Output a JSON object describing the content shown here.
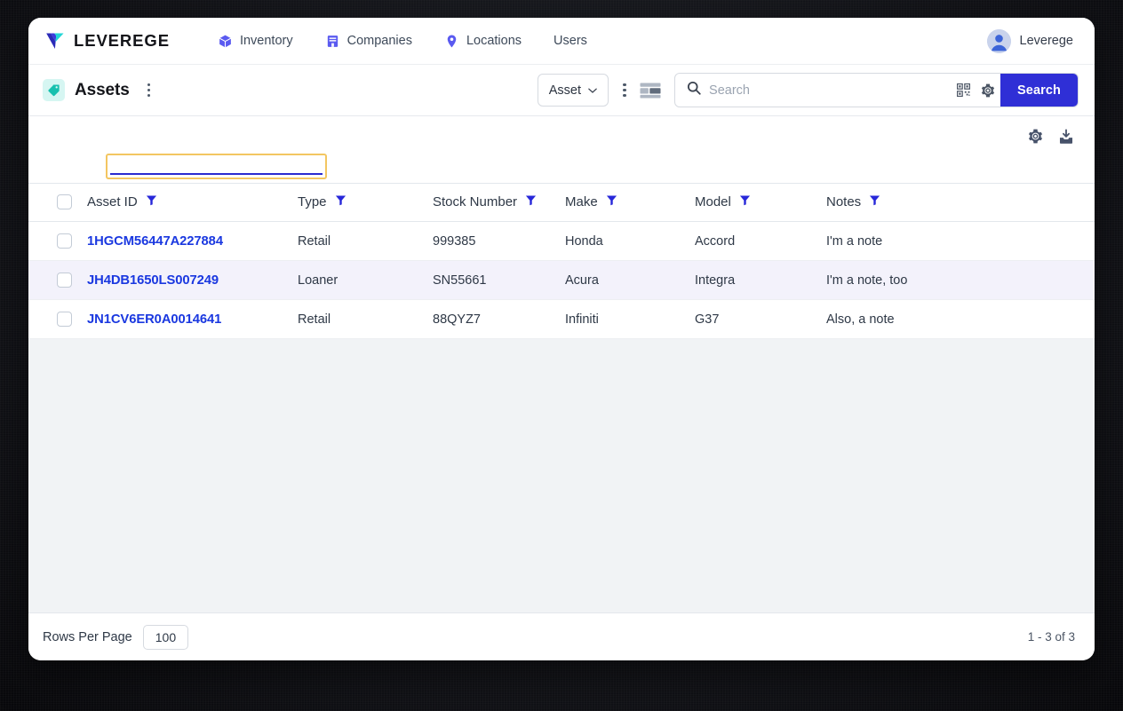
{
  "brand": {
    "name": "LEVEREGE",
    "logo_icon": "leverege-v-logo-icon",
    "colors": {
      "primary_blue": "#2f2fd6",
      "logo_cyan": "#24d8d8",
      "accent_teal": "#16c3b0",
      "focus_amber": "#f3c661",
      "link_blue": "#1a38e0"
    }
  },
  "nav": {
    "items": [
      {
        "label": "Inventory",
        "icon": "cube-icon"
      },
      {
        "label": "Companies",
        "icon": "building-icon"
      },
      {
        "label": "Locations",
        "icon": "map-pin-icon"
      },
      {
        "label": "Users",
        "icon": ""
      }
    ],
    "user": {
      "name": "Leverege",
      "icon": "avatar-person-icon"
    }
  },
  "toolbar": {
    "page_title": "Assets",
    "page_icon": "tag-icon",
    "kebab_icon": "vertical-dots-icon",
    "type_select": {
      "value": "Asset",
      "chevron_icon": "chevron-down-icon"
    },
    "toolbar_kebab_icon": "vertical-dots-icon",
    "layout_toggle_icon": "split-layout-icon",
    "search": {
      "placeholder": "Search",
      "value": "",
      "search_icon": "magnifier-icon",
      "qr_icon": "qr-code-icon",
      "settings_icon": "gear-icon",
      "submit_label": "Search"
    }
  },
  "table_actions": {
    "settings_icon": "gear-icon",
    "download_icon": "download-icon"
  },
  "filter_row": {
    "asset_id_filter": {
      "value": "",
      "placeholder": "",
      "focused": true
    }
  },
  "table": {
    "select_all_checkbox": false,
    "columns": [
      {
        "key": "checkbox",
        "label": "",
        "filterable": false
      },
      {
        "key": "asset_id",
        "label": "Asset ID",
        "filterable": true
      },
      {
        "key": "type",
        "label": "Type",
        "filterable": true
      },
      {
        "key": "stock_number",
        "label": "Stock Number",
        "filterable": true
      },
      {
        "key": "make",
        "label": "Make",
        "filterable": true
      },
      {
        "key": "model",
        "label": "Model",
        "filterable": true
      },
      {
        "key": "notes",
        "label": "Notes",
        "filterable": true
      }
    ],
    "rows": [
      {
        "checked": false,
        "asset_id": "1HGCM56447A227884",
        "type": "Retail",
        "stock_number": "999385",
        "make": "Honda",
        "model": "Accord",
        "notes": "I'm a note",
        "highlighted": false
      },
      {
        "checked": false,
        "asset_id": "JH4DB1650LS007249",
        "type": "Loaner",
        "stock_number": "SN55661",
        "make": "Acura",
        "model": "Integra",
        "notes": "I'm a note, too",
        "highlighted": true
      },
      {
        "checked": false,
        "asset_id": "JN1CV6ER0A0014641",
        "type": "Retail",
        "stock_number": "88QYZ7",
        "make": "Infiniti",
        "model": "G37",
        "notes": "Also, a note",
        "highlighted": false
      }
    ]
  },
  "footer": {
    "rows_per_page_label": "Rows Per Page",
    "rows_per_page_value": "100",
    "pagination_status": "1 - 3 of 3"
  }
}
